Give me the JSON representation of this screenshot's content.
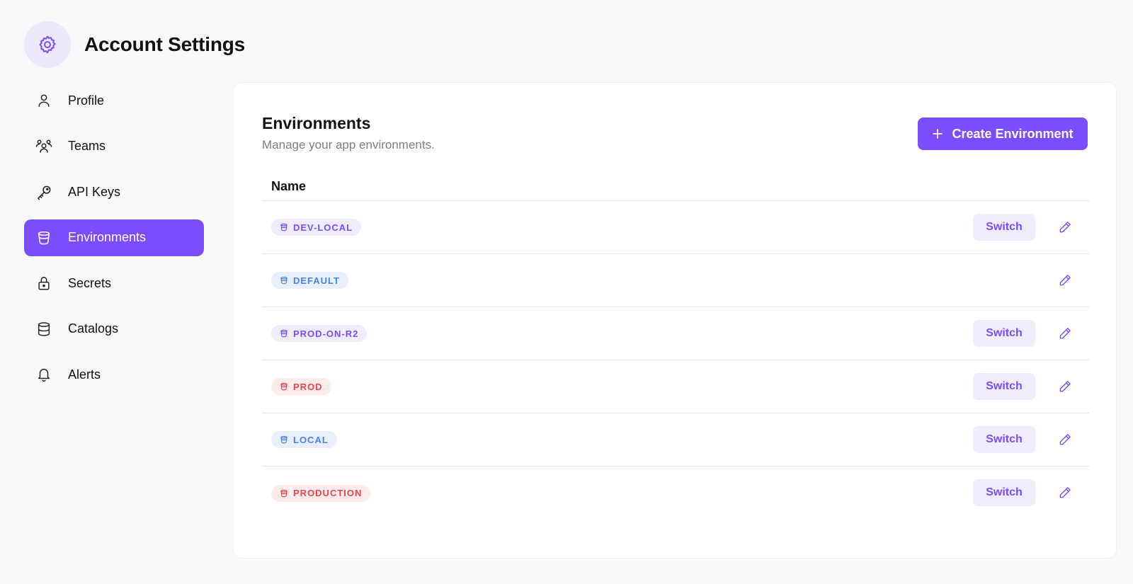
{
  "header": {
    "title": "Account Settings",
    "icon": "gear-icon"
  },
  "sidebar": {
    "items": [
      {
        "label": "Profile",
        "icon": "user-icon",
        "active": false
      },
      {
        "label": "Teams",
        "icon": "users-icon",
        "active": false
      },
      {
        "label": "API Keys",
        "icon": "key-icon",
        "active": false
      },
      {
        "label": "Environments",
        "icon": "bucket-icon",
        "active": true
      },
      {
        "label": "Secrets",
        "icon": "lock-icon",
        "active": false
      },
      {
        "label": "Catalogs",
        "icon": "database-icon",
        "active": false
      },
      {
        "label": "Alerts",
        "icon": "bell-icon",
        "active": false
      }
    ]
  },
  "main": {
    "title": "Environments",
    "subtitle": "Manage your app environments.",
    "create_button_label": "Create Environment",
    "table": {
      "column_header": "Name",
      "switch_label": "Switch",
      "rows": [
        {
          "name": "DEV-LOCAL",
          "color": "purple",
          "has_switch": true
        },
        {
          "name": "DEFAULT",
          "color": "blue",
          "has_switch": false
        },
        {
          "name": "PROD-ON-R2",
          "color": "purple",
          "has_switch": true
        },
        {
          "name": "PROD",
          "color": "red",
          "has_switch": true
        },
        {
          "name": "LOCAL",
          "color": "blue",
          "has_switch": true
        },
        {
          "name": "PRODUCTION",
          "color": "red",
          "has_switch": true
        }
      ]
    }
  },
  "colors": {
    "accent": "#7c4dff",
    "badge_purple": "#7c4dff",
    "badge_blue": "#4a82e8",
    "badge_red": "#e5484d"
  }
}
